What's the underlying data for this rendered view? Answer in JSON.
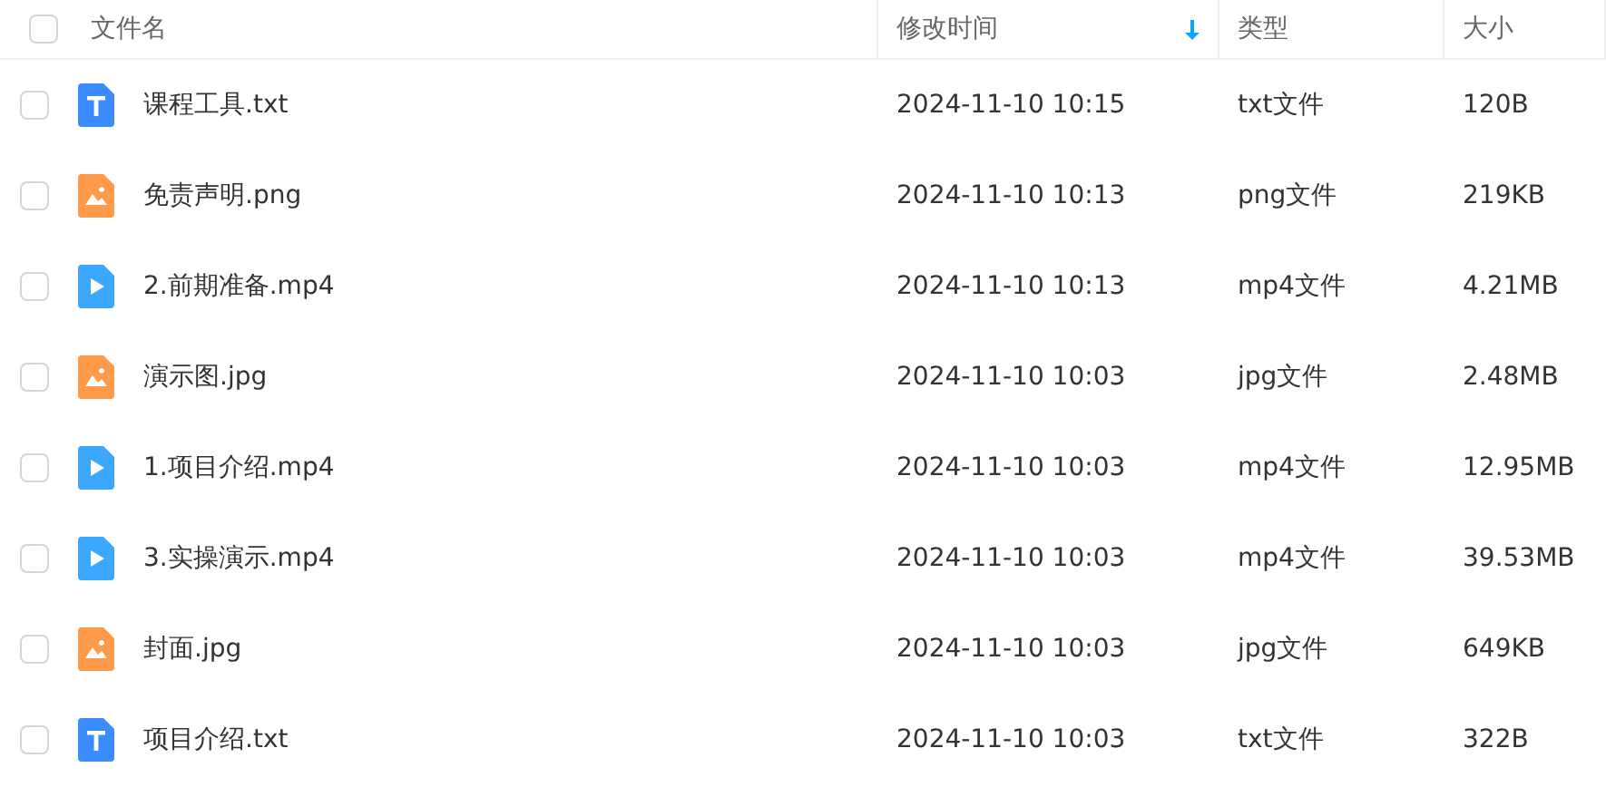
{
  "header": {
    "checked": false,
    "columns": [
      "文件名",
      "修改时间",
      "类型",
      "大小"
    ]
  },
  "rows": [
    {
      "kind": "text",
      "name": "课程工具.txt",
      "modified": "2024-11-10 10:15",
      "type": "txt文件",
      "size": "120B",
      "checked": false
    },
    {
      "kind": "image",
      "name": "免责声明.png",
      "modified": "2024-11-10 10:13",
      "type": "png文件",
      "size": "219KB",
      "checked": false
    },
    {
      "kind": "video",
      "name": "2.前期准备.mp4",
      "modified": "2024-11-10 10:13",
      "type": "mp4文件",
      "size": "4.21MB",
      "checked": false
    },
    {
      "kind": "image",
      "name": "演示图.jpg",
      "modified": "2024-11-10 10:03",
      "type": "jpg文件",
      "size": "2.48MB",
      "checked": false
    },
    {
      "kind": "video",
      "name": "1.项目介绍.mp4",
      "modified": "2024-11-10 10:03",
      "type": "mp4文件",
      "size": "12.95MB",
      "checked": false
    },
    {
      "kind": "video",
      "name": "3.实操演示.mp4",
      "modified": "2024-11-10 10:03",
      "type": "mp4文件",
      "size": "39.53MB",
      "checked": false
    },
    {
      "kind": "image",
      "name": "封面.jpg",
      "modified": "2024-11-10 10:03",
      "type": "jpg文件",
      "size": "649KB",
      "checked": false
    },
    {
      "kind": "text",
      "name": "项目介绍.txt",
      "modified": "2024-11-10 10:03",
      "type": "txt文件",
      "size": "322B",
      "checked": false
    }
  ]
}
